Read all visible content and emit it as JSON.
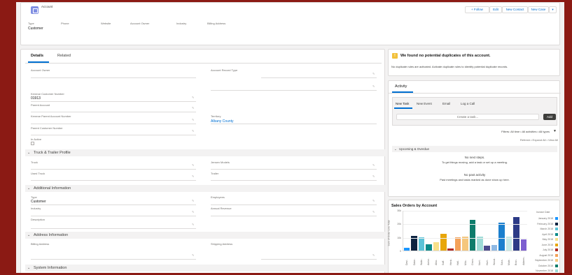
{
  "header": {
    "object_label": "Account",
    "buttons": {
      "follow": "+ Follow",
      "edit": "Edit",
      "new_contact": "New Contact",
      "new_case": "New Case",
      "menu": "▾"
    },
    "fields": [
      {
        "label": "Type",
        "value": "Customer"
      },
      {
        "label": "Phone",
        "value": ""
      },
      {
        "label": "Website",
        "value": ""
      },
      {
        "label": "Account Owner",
        "value": ""
      },
      {
        "label": "Industry",
        "value": ""
      },
      {
        "label": "Billing Address",
        "value": ""
      }
    ]
  },
  "detail": {
    "tabs": {
      "details": "Details",
      "related": "Related"
    },
    "fields": {
      "account_owner": "Account Owner",
      "account_record_type": "Account Record Type",
      "kenmar_customer_number": "Kenmar Customer Number",
      "kenmar_customer_number_value": "01913",
      "parent_account": "Parent Account",
      "kenmar_parent_account_number": "Kenmar Parent Account Number",
      "territory": "Territory",
      "territory_value": "Albany County",
      "parent_customer_number": "Parent Customer Number",
      "in_active": "In Active"
    },
    "sections": {
      "truck_trailer": "Truck & Trailer Profile",
      "additional": "Additional Information",
      "address": "Address Information",
      "system": "System Information"
    },
    "truck_fields": {
      "truck": "Truck",
      "jensen_models": "Jensen Models",
      "used_truck": "Used Truck",
      "trailer": "Trailer"
    },
    "additional_fields": {
      "type": "Type",
      "type_value": "Customer",
      "employees": "Employees",
      "industry": "Industry",
      "annual_revenue": "Annual Revenue",
      "description": "Description"
    },
    "address_fields": {
      "billing": "Billing Address",
      "shipping": "Shipping Address"
    }
  },
  "duplicates": {
    "title": "We found no potential duplicates of this account.",
    "text": "No duplicate rules are activated. Activate duplicate rules to identify potential duplicate records."
  },
  "activity": {
    "title": "Activity",
    "tabs": [
      "New Task",
      "New Event",
      "Email",
      "Log a Call"
    ],
    "create_placeholder": "Create a task...",
    "add_button": "Add",
    "filters": "Filters: All time • All activities • All types",
    "refresh": "Refresh • Expand All • View All",
    "upcoming_title": "Upcoming & Overdue",
    "no_next_steps": "No next steps.",
    "no_next_steps_sub": "To get things moving, add a task or set up a meeting.",
    "no_past": "No past activity",
    "no_past_sub": "Past meetings and tasks marked as done show up here."
  },
  "colors": {
    "accent_blue": "#0070d2",
    "warning_yellow": "#f2c13c",
    "bar_series": [
      "#1b96ff",
      "#0c2340",
      "#5bc3d8",
      "#0a8a8a",
      "#f7e08a",
      "#e8a60a",
      "#b02a22",
      "#f4a259",
      "#f5c77d",
      "#0e7c6b",
      "#9ddbd7",
      "#4b4a8c",
      "#8fb9e4",
      "#1b7fce",
      "#c7eae8",
      "#2c3a86",
      "#7d5fd0",
      "#6b3a9e"
    ]
  },
  "chart_data": {
    "type": "bar",
    "title": "Sales Orders by Account",
    "ylabel": "Sum of Order Line Total",
    "ylim": [
      0,
      30000
    ],
    "yticks": [
      "0",
      "10k",
      "20k",
      "30k"
    ],
    "legend_title": "Invoice Date",
    "legend_position": "right",
    "legend": [
      "January 2018",
      "February 2018",
      "March 2018",
      "April 2018",
      "May 2018",
      "June 2018",
      "July 2018",
      "August 2018",
      "September 2018",
      "October 2018",
      "November 2018"
    ],
    "categories": [
      "Davi..",
      "Dake..",
      "Wate..",
      "Ambe..",
      "Alba..",
      "Suff..",
      "Henk..",
      "Hall..",
      "Milo..",
      "Onon..",
      "Nort..",
      "Hurt..",
      "Wood..",
      "Sara..",
      "Mate..",
      "Bran..",
      "Adams.."
    ],
    "values": [
      2000,
      11000,
      10000,
      4500,
      6000,
      12500,
      1500,
      10000,
      10500,
      23000,
      10500,
      3500,
      4000,
      20500,
      10500,
      25000,
      8500
    ]
  }
}
